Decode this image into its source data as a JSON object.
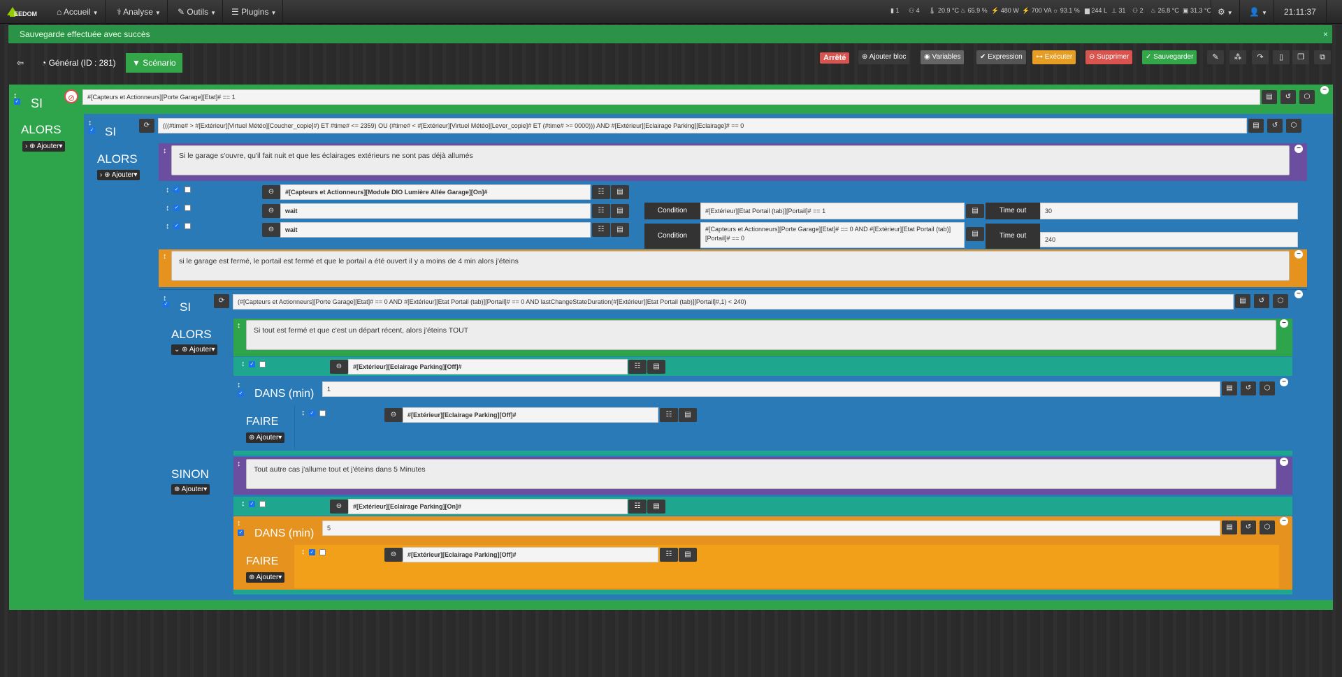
{
  "navbar": {
    "logo": "EEDOM",
    "menus": [
      "Accueil",
      "Analyse",
      "Outils",
      "Plugins"
    ],
    "stats": [
      "1",
      "4",
      "20.9 °C",
      "65.9 %",
      "480 W",
      "700 VA",
      "93.1 %",
      "244 L",
      "31",
      "2",
      "26.8 °C",
      "31.3 °C"
    ],
    "time": "21:11:37"
  },
  "alert": {
    "message": "Sauvegarde effectuée avec succès",
    "close": "×"
  },
  "toolbar": {
    "general_tab": "Général (ID : 281)",
    "scenario_tab": "Scénario",
    "status": "Arrêté",
    "add_block": "Ajouter bloc",
    "variables": "Variables",
    "expression": "Expression",
    "execute": "Exécuter",
    "delete": "Supprimer",
    "save": "Sauvegarder",
    "colors": {
      "status": "#d9534f",
      "execute": "#e69d23",
      "delete": "#d9534f",
      "save": "#33a64a",
      "default": "#3a3a3a"
    }
  },
  "labels": {
    "si": "SI",
    "alors": "ALORS",
    "sinon": "SINON",
    "faire": "FAIRE",
    "dans": "DANS (min)",
    "ajouter": "Ajouter",
    "condition": "Condition",
    "timeout": "Time out"
  },
  "scenario": {
    "si1": "#[Capteurs et Actionneurs][Porte Garage][Etat]# == 1",
    "si2": "(((#time# > #[Extérieur][Virtuel Météo][Coucher_copie]#) ET #time# <= 2359) OU (#time# < #[Extérieur][Virtuel Météo][Lever_copie]# ET (#time# >= 0000))) AND #[Extérieur][Eclairage Parking][Eclairage]# == 0",
    "comment1": "Si le garage s'ouvre, qu'il fait nuit et que les éclairages extérieurs ne sont pas déjà allumés",
    "action1": "#[Capteurs et Actionneurs][Module DIO Lumière Allée Garage][On]#",
    "action2": "wait",
    "action3": "wait",
    "cond2": "#[Extérieur][Etat Portail (tab)][Portail]# == 1",
    "cond3": "#[Capteurs et Actionneurs][Porte Garage][Etat]# == 0 AND #[Extérieur][Etat Portail (tab)][Portail]# == 0",
    "timeout2": "30",
    "timeout3": "240",
    "comment2": "si le garage est fermé, le portail est fermé et que le portail a été ouvert il y a moins de 4 min alors j'éteins",
    "si3": "(#[Capteurs et Actionneurs][Porte Garage][Etat]# == 0 AND #[Extérieur][Etat Portail (tab)][Portail]# == 0 AND lastChangeStateDuration(#[Extérieur][Etat Portail (tab)][Portail]#,1) < 240)",
    "comment3": "Si tout est fermé et que c'est un départ récent, alors j'éteins TOUT",
    "action4": "#[Extérieur][Eclairage Parking][Off]#",
    "dans1": "1",
    "action5": "#[Extérieur][Eclairage Parking][Off]#",
    "comment4": "Tout autre cas j'allume tout et j'éteins dans 5 Minutes",
    "action6": "#[Extérieur][Eclairage Parking][On]#",
    "dans2": "5",
    "action7": "#[Extérieur][Eclairage Parking][Off]#"
  },
  "colors": {
    "green": "#2ea54a",
    "blue": "#2a7ab8",
    "purple": "#6b4ea0",
    "orange": "#e6921e",
    "teal": "#1ea68f"
  }
}
